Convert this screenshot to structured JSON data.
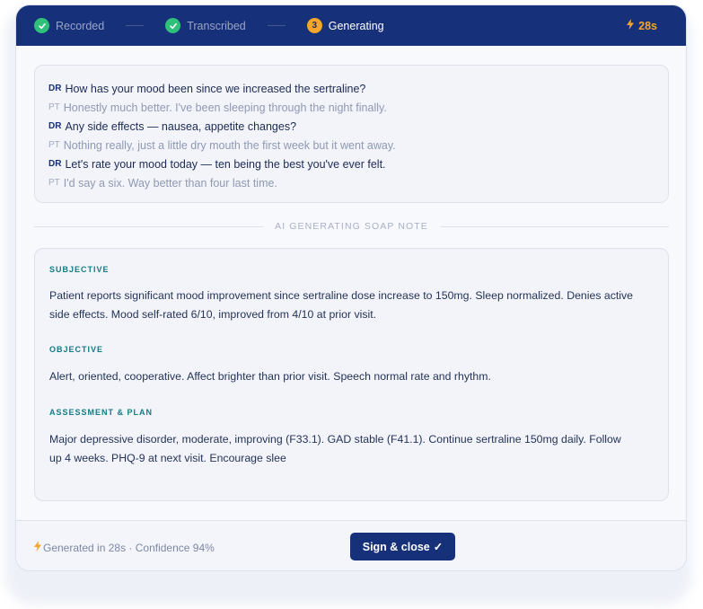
{
  "header": {
    "steps": [
      {
        "label": "Recorded",
        "state": "done"
      },
      {
        "label": "Transcribed",
        "state": "done"
      },
      {
        "label": "Generating",
        "state": "active",
        "number": "3"
      }
    ],
    "timer": "28s"
  },
  "transcript": [
    {
      "speaker": "DR",
      "text": "How has your mood been since we increased the sertraline?"
    },
    {
      "speaker": "PT",
      "text": "Honestly much better. I've been sleeping through the night finally."
    },
    {
      "speaker": "DR",
      "text": "Any side effects — nausea, appetite changes?"
    },
    {
      "speaker": "PT",
      "text": "Nothing really, just a little dry mouth the first week but it went away."
    },
    {
      "speaker": "DR",
      "text": "Let's rate your mood today — ten being the best you've ever felt."
    },
    {
      "speaker": "PT",
      "text": "I'd say a six. Way better than four last time."
    }
  ],
  "divider": {
    "label": "AI GENERATING SOAP NOTE"
  },
  "soap": {
    "subjective": {
      "heading": "SUBJECTIVE",
      "body": "Patient reports significant mood improvement since sertraline dose increase to 150mg. Sleep normalized. Denies active side effects. Mood self-rated 6/10, improved from 4/10 at prior visit."
    },
    "objective": {
      "heading": "OBJECTIVE",
      "body": "Alert, oriented, cooperative. Affect brighter than prior visit. Speech normal rate and rhythm."
    },
    "assessment_plan": {
      "heading": "ASSESSMENT & PLAN",
      "body": "Major depressive disorder, moderate, improving (F33.1). GAD stable (F41.1). Continue sertraline 150mg daily. Follow up 4 weeks. PHQ-9 at next visit. Encourage slee"
    }
  },
  "footer": {
    "status": "Generated in 28s · Confidence 94%",
    "sign_label": "Sign & close",
    "sign_icon": "✓"
  },
  "colors": {
    "header_bg": "#16307a",
    "step_done": "#2fc07a",
    "step_active": "#f4a62a",
    "section_heading": "#137b86"
  }
}
